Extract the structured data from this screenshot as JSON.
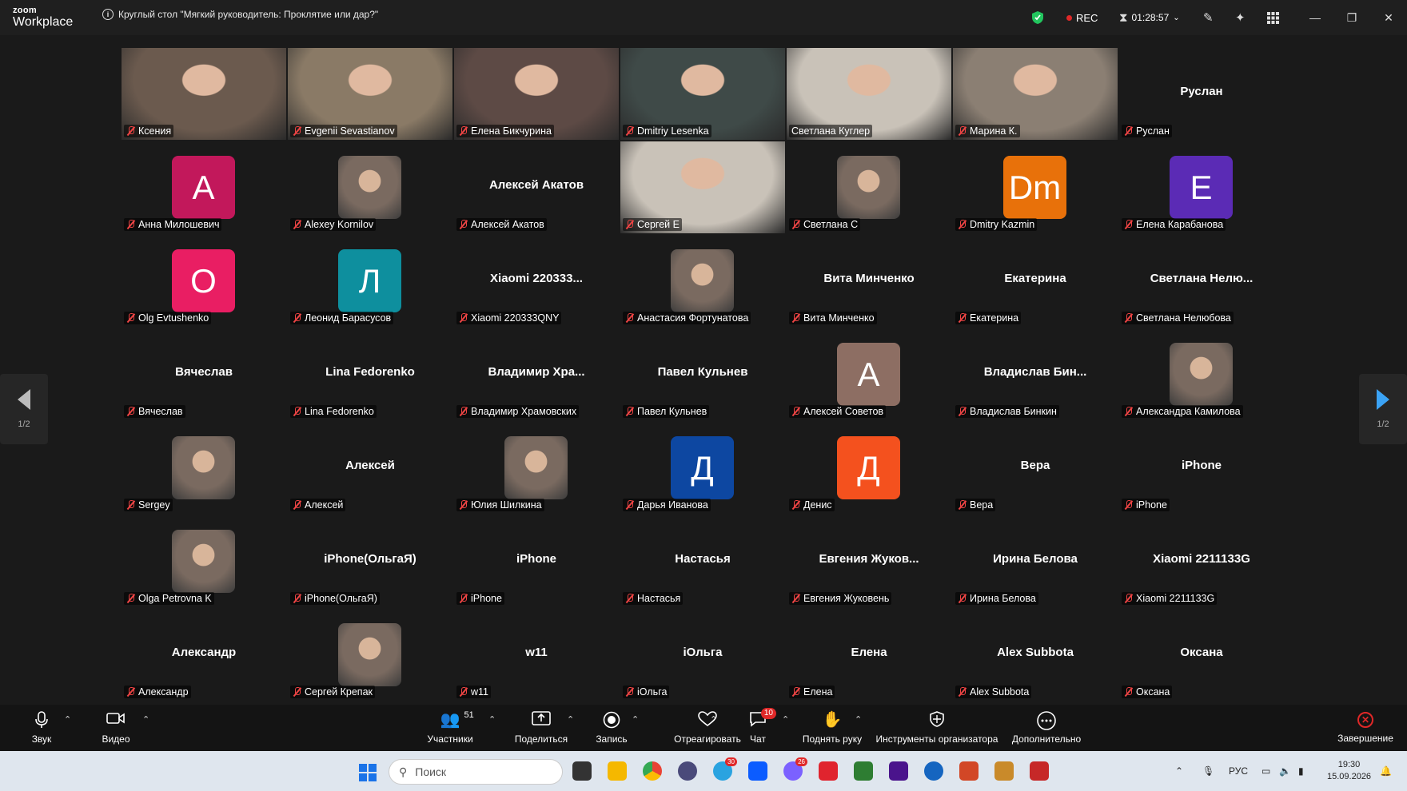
{
  "app": {
    "logo_top": "zoom",
    "logo_bottom": "Workplace",
    "meeting_title": "Круглый стол \"Мягкий руководитель: Проклятие или дар?\""
  },
  "status": {
    "rec_label": "REC",
    "timer": "01:28:57",
    "rec_color": "#e02828",
    "shield_color": "#22c55e",
    "active_speaker_color": "#22c55e"
  },
  "pages": {
    "prev_label": "1/2",
    "next_label": "1/2"
  },
  "participants": [
    {
      "name": "Ксения",
      "kind": "video"
    },
    {
      "name": "Evgenii Sevastianov",
      "kind": "video"
    },
    {
      "name": "Елена Бикчурина",
      "kind": "video"
    },
    {
      "name": "Dmitriy Lesenka",
      "kind": "video"
    },
    {
      "name": "Светлана Куглер",
      "kind": "video",
      "active": true
    },
    {
      "name": "Марина К.",
      "kind": "video"
    },
    {
      "name": "Руслан",
      "kind": "text",
      "display": "Руслан"
    },
    {
      "name": "Анна Милошевич",
      "kind": "initials",
      "initials": "A",
      "color": "#c2185b"
    },
    {
      "name": "Alexey Kornilov",
      "kind": "photo"
    },
    {
      "name": "Алексей Акатов",
      "kind": "text",
      "display": "Алексей Акатов"
    },
    {
      "name": "Сергей Е",
      "kind": "video"
    },
    {
      "name": "Светлана С",
      "kind": "photo"
    },
    {
      "name": "Dmitry Kazmin",
      "kind": "initials",
      "initials": "Dm",
      "color": "#e8710a"
    },
    {
      "name": "Елена Карабанова",
      "kind": "initials",
      "initials": "E",
      "color": "#5b2bb5"
    },
    {
      "name": "Olg Evtushenko",
      "kind": "initials",
      "initials": "O",
      "color": "#e91e63"
    },
    {
      "name": "Леонид Барасусов",
      "kind": "initials",
      "initials": "Л",
      "color": "#0e8f9e"
    },
    {
      "name": "Xiaomi 220333QNY",
      "kind": "text",
      "display": "Xiaomi 220333..."
    },
    {
      "name": "Анастасия Фортунатова",
      "kind": "photo"
    },
    {
      "name": "Вита Минченко",
      "kind": "text",
      "display": "Вита Минченко"
    },
    {
      "name": "Екатерина",
      "kind": "text",
      "display": "Екатерина"
    },
    {
      "name": "Светлана Нелюбова",
      "kind": "text",
      "display": "Светлана Нелю..."
    },
    {
      "name": "Вячеслав",
      "kind": "text",
      "display": "Вячеслав"
    },
    {
      "name": "Lina Fedorenko",
      "kind": "text",
      "display": "Lina Fedorenko"
    },
    {
      "name": "Владимир Храмовских",
      "kind": "text",
      "display": "Владимир Хра..."
    },
    {
      "name": "Павел Кульнев",
      "kind": "text",
      "display": "Павел Кульнев"
    },
    {
      "name": "Алексей Советов",
      "kind": "initials",
      "initials": "A",
      "color": "#8d6e63"
    },
    {
      "name": "Владислав Бинкин",
      "kind": "text",
      "display": "Владислав Бин..."
    },
    {
      "name": "Александра Камилова",
      "kind": "photo"
    },
    {
      "name": "Sergey",
      "kind": "photo"
    },
    {
      "name": "Алексей",
      "kind": "text",
      "display": "Алексей"
    },
    {
      "name": "Юлия Шилкина",
      "kind": "photo"
    },
    {
      "name": "Дарья Иванова",
      "kind": "initials",
      "initials": "Д",
      "color": "#0d47a1"
    },
    {
      "name": "Денис",
      "kind": "initials",
      "initials": "Д",
      "color": "#f4511e"
    },
    {
      "name": "Вера",
      "kind": "text",
      "display": "Вера"
    },
    {
      "name": "iPhone",
      "kind": "text",
      "display": "iPhone"
    },
    {
      "name": "Olga Petrovna K",
      "kind": "photo"
    },
    {
      "name": "iPhone(ОльгаЯ)",
      "kind": "text",
      "display": "iPhone(ОльгаЯ)"
    },
    {
      "name": "iPhone",
      "kind": "text",
      "display": "iPhone"
    },
    {
      "name": "Настасья",
      "kind": "text",
      "display": "Настасья"
    },
    {
      "name": "Евгения Жуковень",
      "kind": "text",
      "display": "Евгения  Жуков..."
    },
    {
      "name": "Ирина Белова",
      "kind": "text",
      "display": "Ирина Белова"
    },
    {
      "name": "Xiaomi 2211133G",
      "kind": "text",
      "display": "Xiaomi 2211133G"
    },
    {
      "name": "Александр",
      "kind": "text",
      "display": "Александр"
    },
    {
      "name": "Сергей Крепак",
      "kind": "photo"
    },
    {
      "name": "w11",
      "kind": "text",
      "display": "w11"
    },
    {
      "name": "iОльга",
      "kind": "text",
      "display": "iОльга"
    },
    {
      "name": "Елена",
      "kind": "text",
      "display": "Елена"
    },
    {
      "name": "Alex Subbota",
      "kind": "text",
      "display": "Alex Subbota"
    },
    {
      "name": "Оксана",
      "kind": "text",
      "display": "Оксана"
    }
  ],
  "toolbar": {
    "audio": "Звук",
    "video": "Видео",
    "participants": "Участники",
    "participants_count": "51",
    "share": "Поделиться",
    "record": "Запись",
    "react": "Отреагировать",
    "chat": "Чат",
    "chat_badge": "10",
    "raise": "Поднять руку",
    "host_tools": "Инструменты организатора",
    "more": "Дополнительно",
    "end": "Завершение"
  },
  "taskbar": {
    "search_placeholder": "Поиск",
    "lang": "РУС",
    "time": "19:30",
    "date": "15.09.2026",
    "telegram_badge": "30",
    "messenger_badge": "26"
  }
}
